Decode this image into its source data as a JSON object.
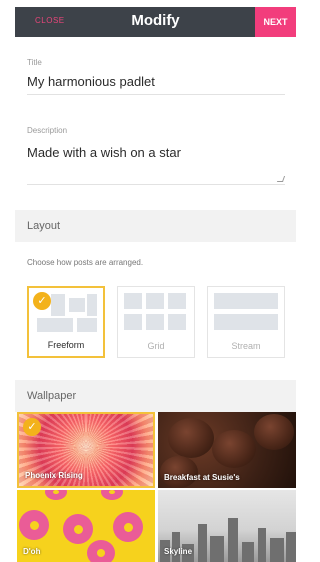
{
  "header": {
    "close_label": "CLOSE",
    "title": "Modify",
    "next_label": "NEXT"
  },
  "form": {
    "title_label": "Title",
    "title_value": "My harmonious padlet",
    "description_label": "Description",
    "description_value": "Made with a wish on a star"
  },
  "layout": {
    "heading": "Layout",
    "description": "Choose how posts are arranged.",
    "options": [
      {
        "label": "Freeform",
        "selected": true
      },
      {
        "label": "Grid",
        "selected": false
      },
      {
        "label": "Stream",
        "selected": false
      }
    ]
  },
  "wallpaper": {
    "heading": "Wallpaper",
    "items": [
      {
        "label": "Phoenix Rising",
        "selected": true
      },
      {
        "label": "Breakfast at Susie's",
        "selected": false
      },
      {
        "label": "D'oh",
        "selected": false
      },
      {
        "label": "Skyline",
        "selected": false
      }
    ]
  },
  "colors": {
    "header_bg": "#3d4249",
    "accent": "#f23d7c",
    "selected": "#f3c13a"
  },
  "icons": {
    "check": "checkmark-icon",
    "grip": "resize-grip-icon"
  }
}
